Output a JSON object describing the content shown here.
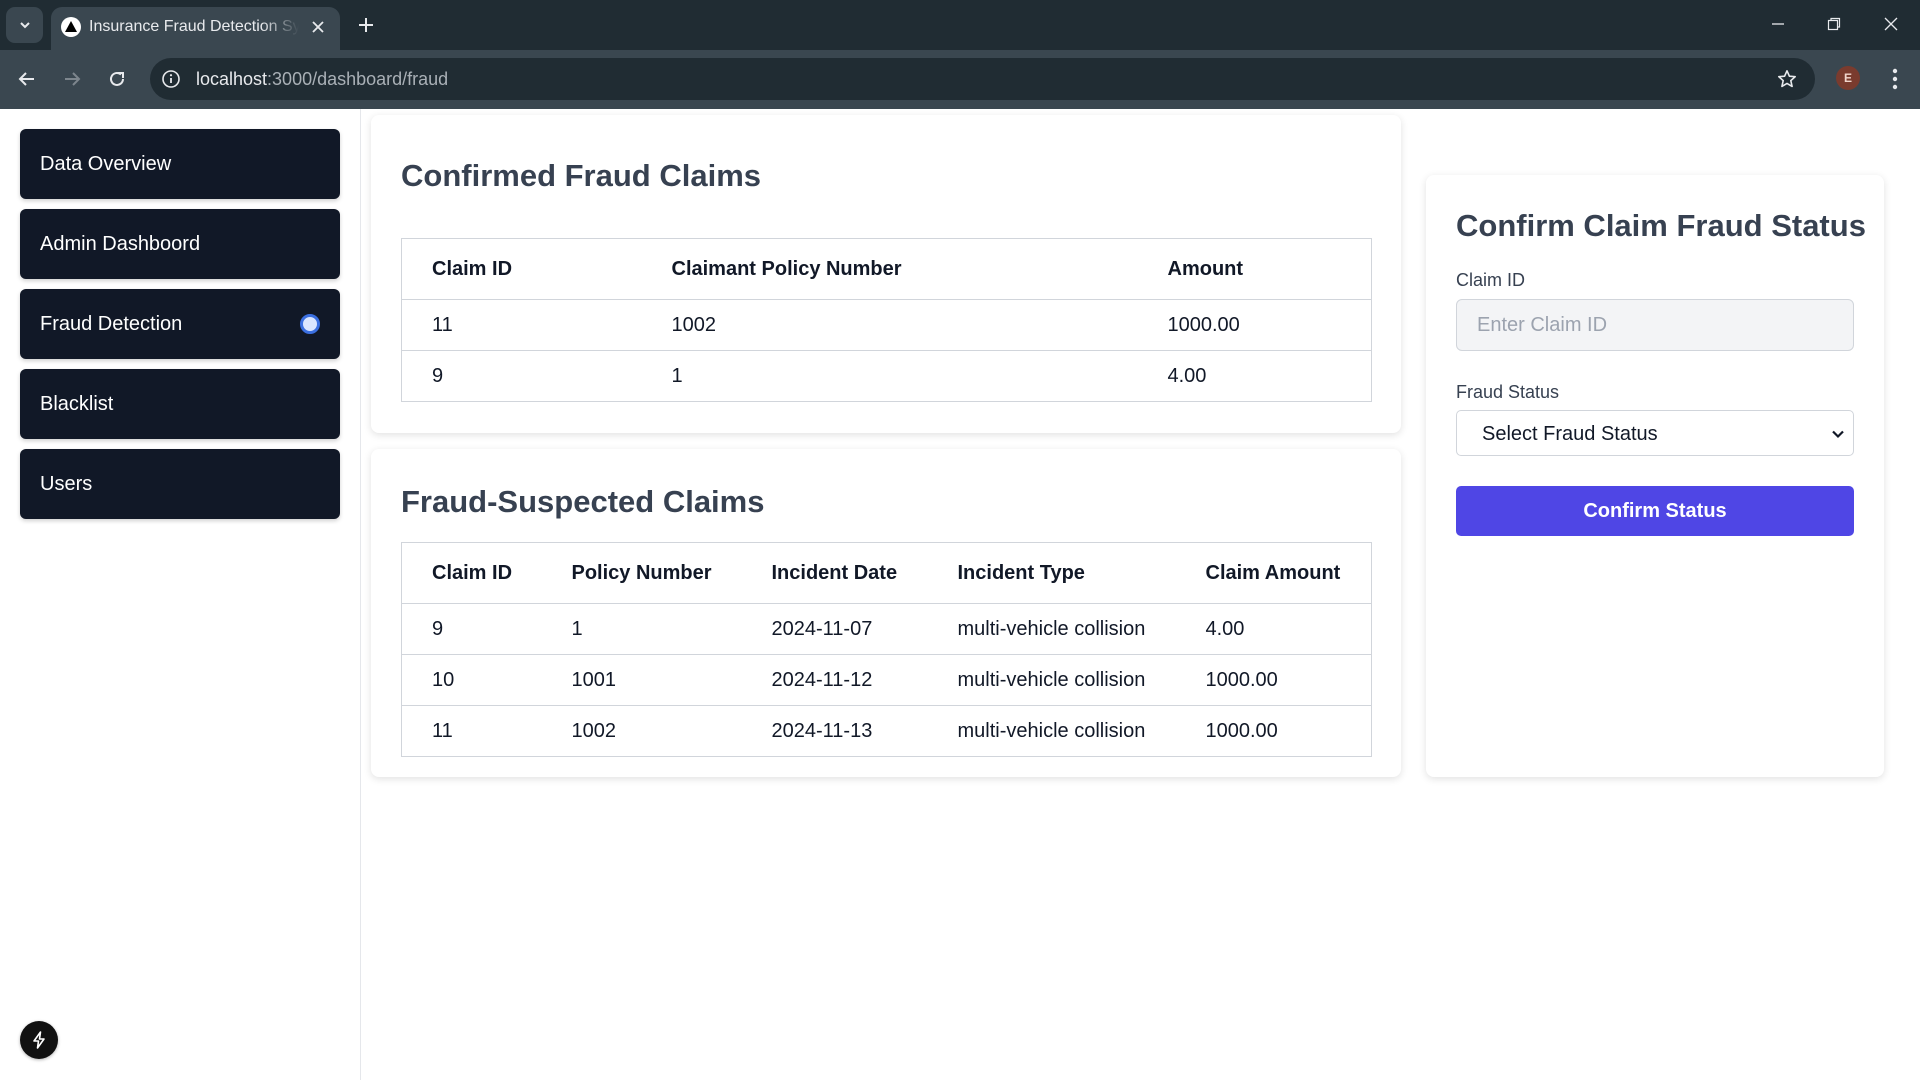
{
  "browser": {
    "tab_title": "Insurance Fraud Detection System",
    "url_host": "localhost",
    "url_rest": ":3000/dashboard/fraud",
    "profile_initial": "E"
  },
  "sidebar": {
    "items": [
      {
        "label": "Data Overview",
        "active": false
      },
      {
        "label": "Admin Dashboord",
        "active": false
      },
      {
        "label": "Fraud Detection",
        "active": true
      },
      {
        "label": "Blacklist",
        "active": false
      },
      {
        "label": "Users",
        "active": false
      }
    ]
  },
  "confirmed": {
    "title": "Confirmed Fraud Claims",
    "headers": [
      "Claim ID",
      "Claimant Policy Number",
      "Amount"
    ],
    "rows": [
      [
        "11",
        "1002",
        "1000.00"
      ],
      [
        "9",
        "1",
        "4.00"
      ]
    ]
  },
  "suspected": {
    "title": "Fraud-Suspected Claims",
    "headers": [
      "Claim ID",
      "Policy Number",
      "Incident Date",
      "Incident Type",
      "Claim Amount"
    ],
    "rows": [
      [
        "9",
        "1",
        "2024-11-07",
        "multi-vehicle collision",
        "4.00"
      ],
      [
        "10",
        "1001",
        "2024-11-12",
        "multi-vehicle collision",
        "1000.00"
      ],
      [
        "11",
        "1002",
        "2024-11-13",
        "multi-vehicle collision",
        "1000.00"
      ]
    ]
  },
  "form": {
    "title": "Confirm Claim Fraud Status",
    "claim_id_label": "Claim ID",
    "claim_id_placeholder": "Enter Claim ID",
    "claim_id_value": "",
    "fraud_status_label": "Fraud Status",
    "fraud_status_selected": "Select Fraud Status",
    "submit_label": "Confirm Status"
  },
  "colors": {
    "sidebar_item_bg": "#111827",
    "primary_button": "#4f46e5",
    "title_text": "#374151",
    "browser_frame": "#202c33"
  }
}
